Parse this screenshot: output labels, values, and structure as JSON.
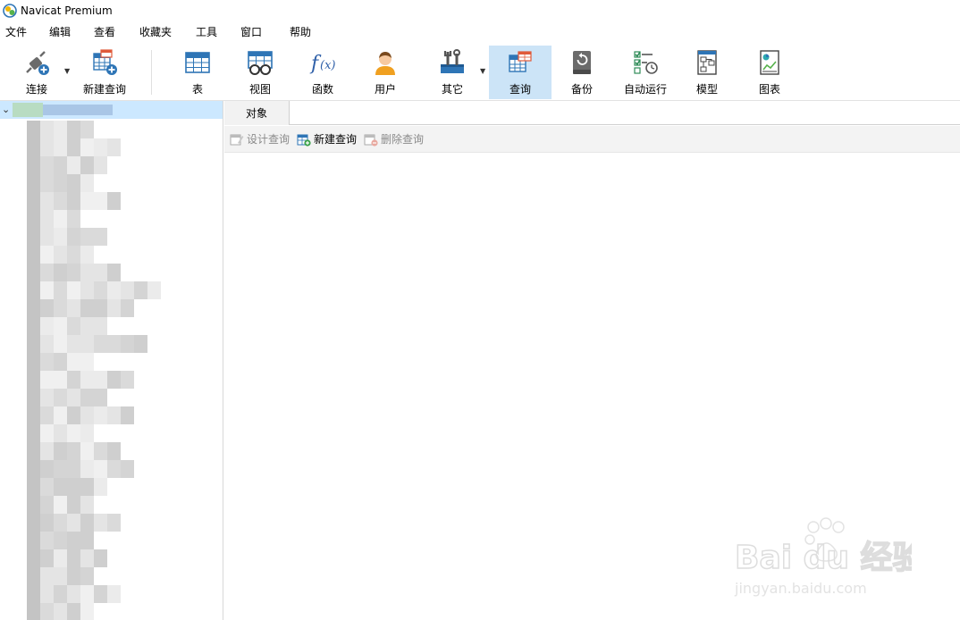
{
  "window": {
    "title": "Navicat Premium",
    "logo_icon": "navicat-logo-icon"
  },
  "menu": {
    "items": [
      {
        "label": "文件"
      },
      {
        "label": "编辑"
      },
      {
        "label": "查看"
      },
      {
        "label": "收藏夹"
      },
      {
        "label": "工具"
      },
      {
        "label": "窗口"
      },
      {
        "label": "帮助"
      }
    ]
  },
  "toolbar": {
    "items": [
      {
        "label": "连接",
        "icon": "plug-connection-icon",
        "has_dropdown": true
      },
      {
        "label": "新建查询",
        "icon": "new-query-icon"
      },
      {
        "label": "表",
        "icon": "table-icon"
      },
      {
        "label": "视图",
        "icon": "view-glasses-icon"
      },
      {
        "label": "函数",
        "icon": "function-fx-icon"
      },
      {
        "label": "用户",
        "icon": "user-icon"
      },
      {
        "label": "其它",
        "icon": "tools-icon",
        "has_dropdown": true
      },
      {
        "label": "查询",
        "icon": "query-table-icon",
        "active": true
      },
      {
        "label": "备份",
        "icon": "backup-icon"
      },
      {
        "label": "自动运行",
        "icon": "auto-run-checklist-icon"
      },
      {
        "label": "模型",
        "icon": "model-diagram-icon"
      },
      {
        "label": "图表",
        "icon": "chart-report-icon"
      }
    ],
    "active_color": "#cce4f7"
  },
  "objects_panel": {
    "tab_label": "对象",
    "actions": [
      {
        "label": "设计查询",
        "enabled": false,
        "icon": "design-query-icon"
      },
      {
        "label": "新建查询",
        "enabled": true,
        "icon": "new-query-icon"
      },
      {
        "label": "删除查询",
        "enabled": false,
        "icon": "delete-query-icon"
      }
    ]
  },
  "colors": {
    "tree_selected": "#cce8ff",
    "accent_blue": "#2e75b6"
  },
  "watermark": {
    "brand": "Bai du 经验",
    "url": "jingyan.baidu.com"
  }
}
